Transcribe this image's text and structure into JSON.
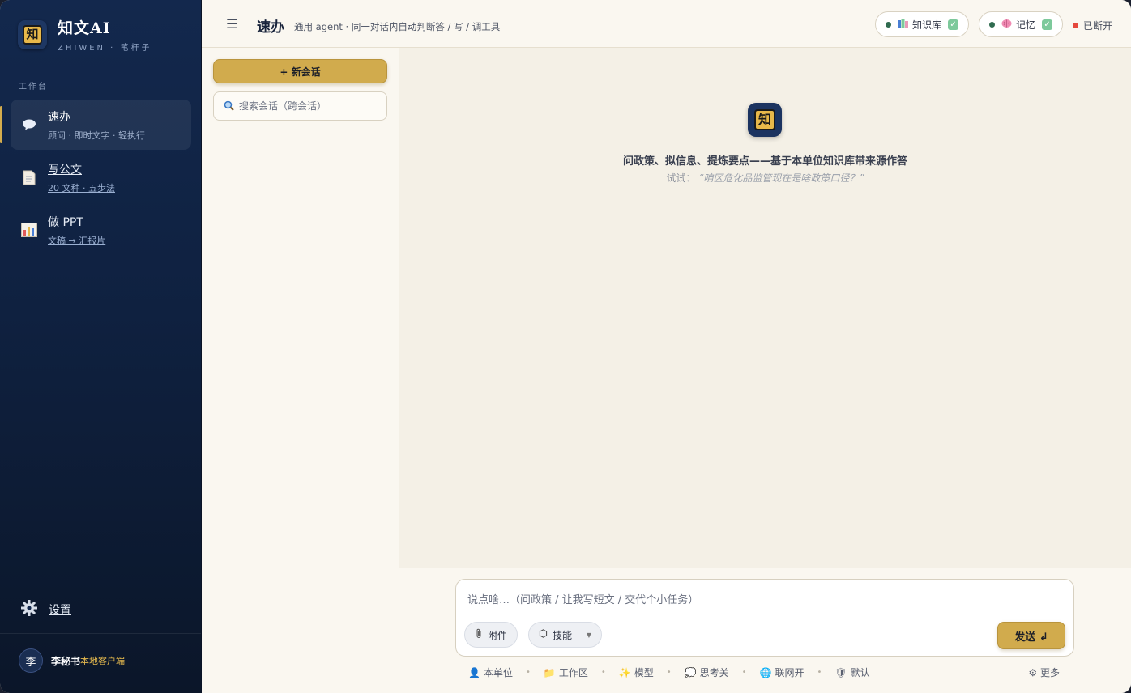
{
  "brand": {
    "name": "知文AI",
    "sub": "ZHIWEN · 笔杆子",
    "logo_char": "知"
  },
  "sidebar": {
    "section_label": "工作台",
    "items": [
      {
        "title": "速办",
        "sub": "顾问 · 即时文字 · 轻执行",
        "icon": "speech-bubble-icon"
      },
      {
        "title": "写公文",
        "sub": "20 文种 · 五步法",
        "icon": "document-icon"
      },
      {
        "title": "做 PPT",
        "sub": "文稿 → 汇报片",
        "icon": "bar-chart-icon"
      }
    ],
    "settings_label": "设置",
    "user": {
      "avatar": "李",
      "name": "李秘书",
      "tag": "本地客户端"
    }
  },
  "header": {
    "menu_icon": "☰",
    "title": "速办",
    "subtitle": "通用 agent · 同一对话内自动判断答 / 写 / 调工具",
    "kb_label": "知识库",
    "memory_label": "记忆",
    "status_label": "已断开"
  },
  "convlist": {
    "new_chat_label": "+ 新会话",
    "search_placeholder": "搜索会话（跨会话）"
  },
  "hero": {
    "logo_char": "知",
    "title": "问政策、拟信息、提炼要点——基于本单位知识库带来源作答",
    "hint_prefix": "试试：",
    "hint_quote": "“咱区危化品监管现在是啥政策口径？”"
  },
  "composer": {
    "placeholder": "说点啥…（问政策 / 让我写短文 / 交代个小任务）",
    "attach_label": "附件",
    "skills_label": "技能",
    "send_label": "发送 ↲"
  },
  "status_bar": {
    "items": [
      {
        "icon": "👤",
        "label": "本单位"
      },
      {
        "icon": "📁",
        "label": "工作区"
      },
      {
        "icon": "✨",
        "label": "模型"
      },
      {
        "icon": "💭",
        "label": "思考关"
      },
      {
        "icon": "🌐",
        "label": "联网开"
      },
      {
        "icon": "🛡",
        "label": "默认"
      }
    ],
    "more_label": "⚙ 更多"
  },
  "colors": {
    "accent": "#d1ab4d",
    "sidebar": "#0f2140",
    "ok": "#2f6b4f",
    "error": "#e5483d"
  }
}
